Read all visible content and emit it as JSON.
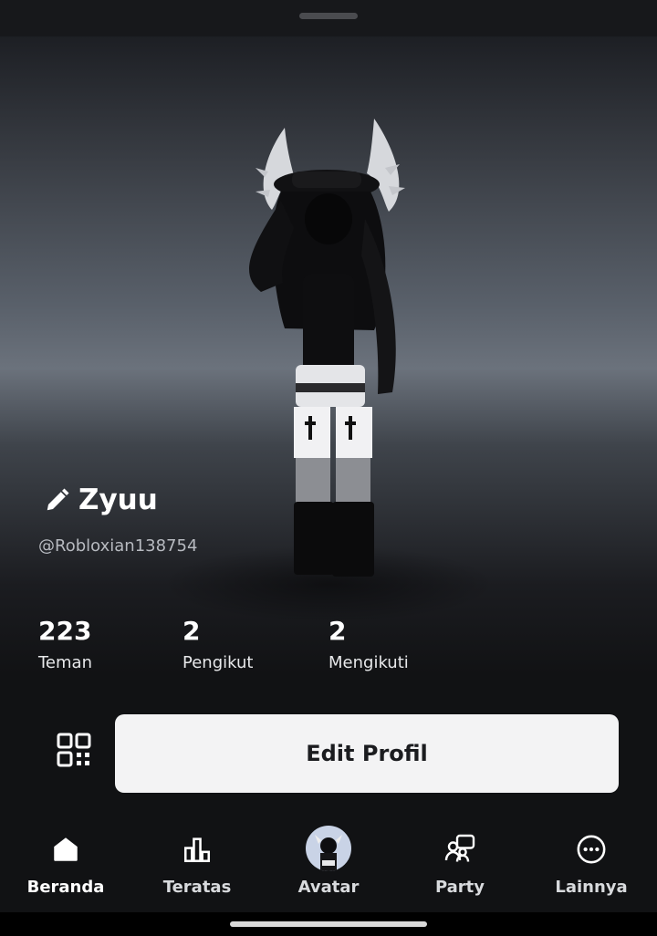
{
  "profile": {
    "display_name": "Zyuu",
    "username": "@Robloxian138754"
  },
  "stats": [
    {
      "value": "223",
      "label": "Teman"
    },
    {
      "value": "2",
      "label": "Pengikut"
    },
    {
      "value": "2",
      "label": "Mengikuti"
    }
  ],
  "actions": {
    "edit_label": "Edit Profil"
  },
  "nav": {
    "items": [
      {
        "label": "Beranda",
        "icon": "home-icon",
        "active": true
      },
      {
        "label": "Teratas",
        "icon": "charts-icon"
      },
      {
        "label": "Avatar",
        "icon": "avatar-thumbnail"
      },
      {
        "label": "Party",
        "icon": "party-icon"
      },
      {
        "label": "Lainnya",
        "icon": "more-icon"
      }
    ]
  },
  "colors": {
    "background": "#111214",
    "button_bg": "#f3f3f4",
    "button_text": "#1b1c1f"
  }
}
